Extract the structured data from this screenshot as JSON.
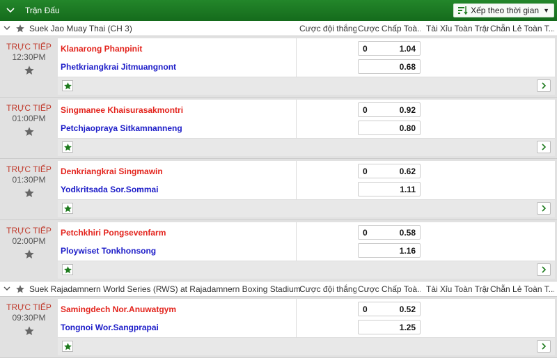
{
  "header": {
    "title": "Trận Đấu",
    "sort_label": "Xếp theo thời gian"
  },
  "columns": [
    "Cược đội thắng",
    "Cược Chấp Toà...",
    "Tài Xỉu Toàn Trận",
    "Chẵn Lẻ Toàn T..."
  ],
  "leagues": [
    {
      "name": "Suek Jao Muay Thai (CH 3)",
      "matches": [
        {
          "status": "TRỰC TIẾP",
          "time": "12:30PM",
          "home": "Klanarong Phanpinit",
          "away": "Phetkriangkrai Jitmuangnont",
          "hdp": "0",
          "home_odds": "1.04",
          "away_odds": "0.68"
        },
        {
          "status": "TRỰC TIẾP",
          "time": "01:00PM",
          "home": "Singmanee Khaisurasakmontri",
          "away": "Petchjaopraya Sitkamnanneng",
          "hdp": "0",
          "home_odds": "0.92",
          "away_odds": "0.80"
        },
        {
          "status": "TRỰC TIẾP",
          "time": "01:30PM",
          "home": "Denkriangkrai Singmawin",
          "away": "Yodkritsada Sor.Sommai",
          "hdp": "0",
          "home_odds": "0.62",
          "away_odds": "1.11"
        },
        {
          "status": "TRỰC TIẾP",
          "time": "02:00PM",
          "home": "Petchkhiri Pongsevenfarm",
          "away": "Ploywiset Tonkhonsong",
          "hdp": "0",
          "home_odds": "0.58",
          "away_odds": "1.16"
        }
      ]
    },
    {
      "name": "Suek Rajadamnern World Series (RWS) at Rajadamnern Boxing Stadium",
      "matches": [
        {
          "status": "TRỰC TIẾP",
          "time": "09:30PM",
          "home": "Samingdech Nor.Anuwatgym",
          "away": "Tongnoi Wor.Sangprapai",
          "hdp": "0",
          "home_odds": "0.52",
          "away_odds": "1.25"
        }
      ]
    }
  ],
  "colors": {
    "header_green": "#1e7b1e",
    "home": "#e3231c",
    "away": "#1c1cc8",
    "live": "#c0392b"
  }
}
